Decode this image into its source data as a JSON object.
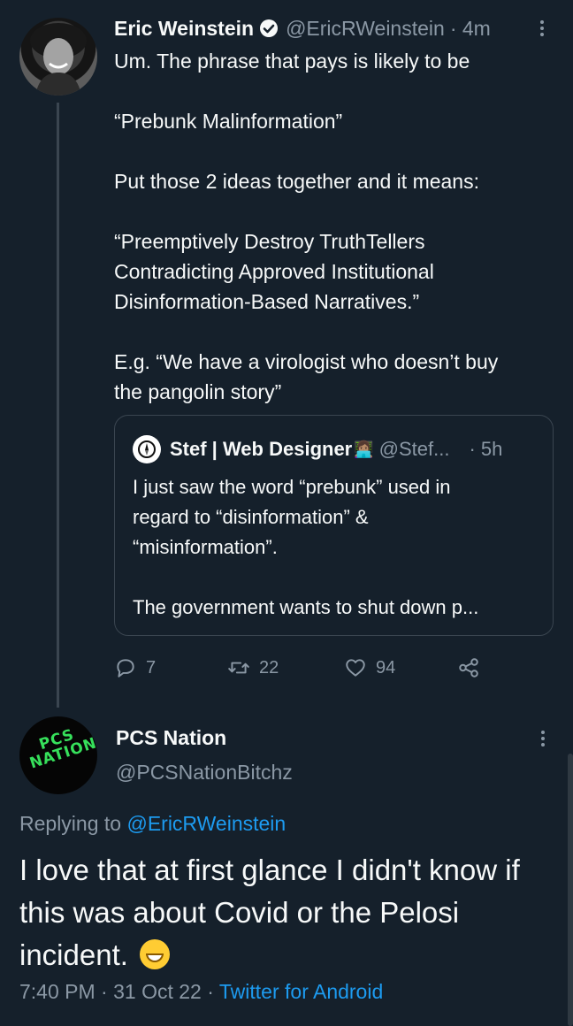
{
  "tweet1": {
    "author_name": "Eric Weinstein",
    "handle": "@EricRWeinstein",
    "time": "· 4m",
    "text": "Um. The phrase that pays is likely to be\n\n“Prebunk Malinformation”\n\nPut those 2 ideas together and it means:\n\n“Preemptively Destroy TruthTellers\nContradicting Approved Institutional\nDisinformation-Based Narratives.”\n\nE.g. “We have a virologist who doesn’t buy\nthe pangolin story”",
    "quote": {
      "author_name": "Stef | Web Designer",
      "author_emoji": "👩🏽‍💻",
      "handle": "@Stef...",
      "time": "· 5h",
      "text": "I just saw the word “prebunk” used in\nregard to “disinformation” &\n“misinformation”.\n\nThe government wants to shut down p..."
    },
    "actions": {
      "replies": "7",
      "retweets": "22",
      "likes": "94"
    }
  },
  "tweet2": {
    "author_name": "PCS Nation",
    "handle": "@PCSNationBitchz",
    "avatar_text": "PCS NATION",
    "replying_prefix": "Replying to ",
    "replying_handle": "@EricRWeinstein",
    "text": "I love that at first glance I didn't know if this was about Covid or the Pelosi incident.",
    "time": "7:40 PM",
    "date": "31 Oct 22",
    "source": "Twitter for Android"
  },
  "colors": {
    "background": "#15202b",
    "text": "#f7f9f9",
    "muted": "#8b98a5",
    "link": "#1d9bf0",
    "border": "#3a4550",
    "pcs_green": "#36e05b"
  }
}
